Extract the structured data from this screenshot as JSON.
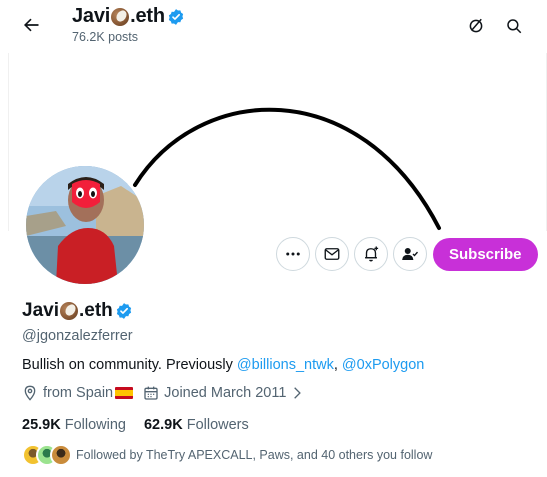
{
  "header": {
    "name_prefix": "Javi",
    "name_suffix": ".eth",
    "posts_count": "76.2K posts",
    "back_icon": "arrow-left-icon",
    "feed_icon": "hide-repost-icon",
    "search_icon": "search-icon"
  },
  "profile": {
    "name_prefix": "Javi",
    "name_suffix": ".eth",
    "handle": "@jgonzalezferrer",
    "bio_text": "Bullish on community. Previously ",
    "bio_mention_1": "@billions_ntwk",
    "bio_separator": ", ",
    "bio_mention_2": "@0xPolygon",
    "location": "from Spain",
    "joined": "Joined March 2011",
    "following_count": "25.9K",
    "following_label": "Following",
    "followers_count": "62.9K",
    "followers_label": "Followers",
    "followed_by": "Followed by TheTry APEXCALL, Paws, and 40 others you follow"
  },
  "actions": {
    "more_icon": "more-icon",
    "message_icon": "envelope-icon",
    "notify_icon": "bell-plus-icon",
    "follow_icon": "person-check-icon",
    "subscribe_label": "Subscribe"
  },
  "colors": {
    "accent": "#1d9bf0",
    "subscribe": "#c830d8",
    "text_primary": "#0f1419",
    "text_secondary": "#536471"
  }
}
